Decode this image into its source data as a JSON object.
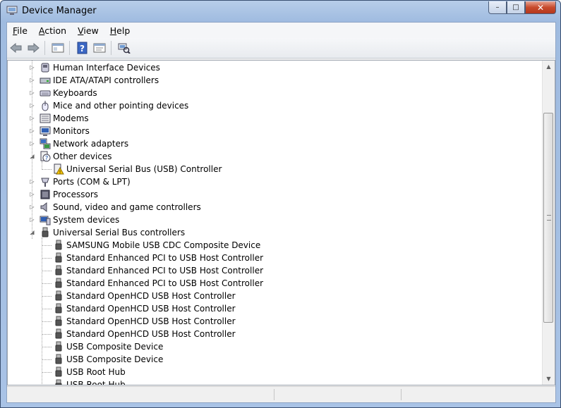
{
  "window": {
    "title": "Device Manager",
    "controls": {
      "minimize": "–",
      "maximize": "□",
      "close": "✕"
    }
  },
  "menu": [
    {
      "label": "File",
      "accel": "F",
      "rest": "ile"
    },
    {
      "label": "Action",
      "accel": "A",
      "rest": "ction"
    },
    {
      "label": "View",
      "accel": "V",
      "rest": "iew"
    },
    {
      "label": "Help",
      "accel": "H",
      "rest": "elp"
    }
  ],
  "toolbar": [
    "back-icon",
    "forward-icon",
    "show-hide-console-tree-icon",
    "help-icon",
    "properties-icon",
    "scan-hardware-icon"
  ],
  "tree": [
    {
      "label": "Human Interface Devices",
      "level": 0,
      "expanded": false,
      "icon": "hid-icon"
    },
    {
      "label": "IDE ATA/ATAPI controllers",
      "level": 0,
      "expanded": false,
      "icon": "ide-icon"
    },
    {
      "label": "Keyboards",
      "level": 0,
      "expanded": false,
      "icon": "keyboard-icon"
    },
    {
      "label": "Mice and other pointing devices",
      "level": 0,
      "expanded": false,
      "icon": "mouse-icon"
    },
    {
      "label": "Modems",
      "level": 0,
      "expanded": false,
      "icon": "modem-icon"
    },
    {
      "label": "Monitors",
      "level": 0,
      "expanded": false,
      "icon": "monitor-icon"
    },
    {
      "label": "Network adapters",
      "level": 0,
      "expanded": false,
      "icon": "network-icon"
    },
    {
      "label": "Other devices",
      "level": 0,
      "expanded": true,
      "icon": "other-devices-icon"
    },
    {
      "label": "Universal Serial Bus (USB) Controller",
      "level": 1,
      "icon": "warning-device-icon"
    },
    {
      "label": "Ports (COM & LPT)",
      "level": 0,
      "expanded": false,
      "icon": "port-icon"
    },
    {
      "label": "Processors",
      "level": 0,
      "expanded": false,
      "icon": "processor-icon"
    },
    {
      "label": "Sound, video and game controllers",
      "level": 0,
      "expanded": false,
      "icon": "sound-icon"
    },
    {
      "label": "System devices",
      "level": 0,
      "expanded": false,
      "icon": "system-icon"
    },
    {
      "label": "Universal Serial Bus controllers",
      "level": 0,
      "expanded": true,
      "icon": "usb-icon"
    },
    {
      "label": "SAMSUNG Mobile USB CDC Composite Device",
      "level": 1,
      "icon": "usb-icon"
    },
    {
      "label": "Standard Enhanced PCI to USB Host Controller",
      "level": 1,
      "icon": "usb-icon"
    },
    {
      "label": "Standard Enhanced PCI to USB Host Controller",
      "level": 1,
      "icon": "usb-icon"
    },
    {
      "label": "Standard Enhanced PCI to USB Host Controller",
      "level": 1,
      "icon": "usb-icon"
    },
    {
      "label": "Standard OpenHCD USB Host Controller",
      "level": 1,
      "icon": "usb-icon"
    },
    {
      "label": "Standard OpenHCD USB Host Controller",
      "level": 1,
      "icon": "usb-icon"
    },
    {
      "label": "Standard OpenHCD USB Host Controller",
      "level": 1,
      "icon": "usb-icon"
    },
    {
      "label": "Standard OpenHCD USB Host Controller",
      "level": 1,
      "icon": "usb-icon"
    },
    {
      "label": "USB Composite Device",
      "level": 1,
      "icon": "usb-icon"
    },
    {
      "label": "USB Composite Device",
      "level": 1,
      "icon": "usb-icon"
    },
    {
      "label": "USB Root Hub",
      "level": 1,
      "icon": "usb-icon"
    },
    {
      "label": "USB Root Hub",
      "level": 1,
      "icon": "usb-icon"
    }
  ]
}
